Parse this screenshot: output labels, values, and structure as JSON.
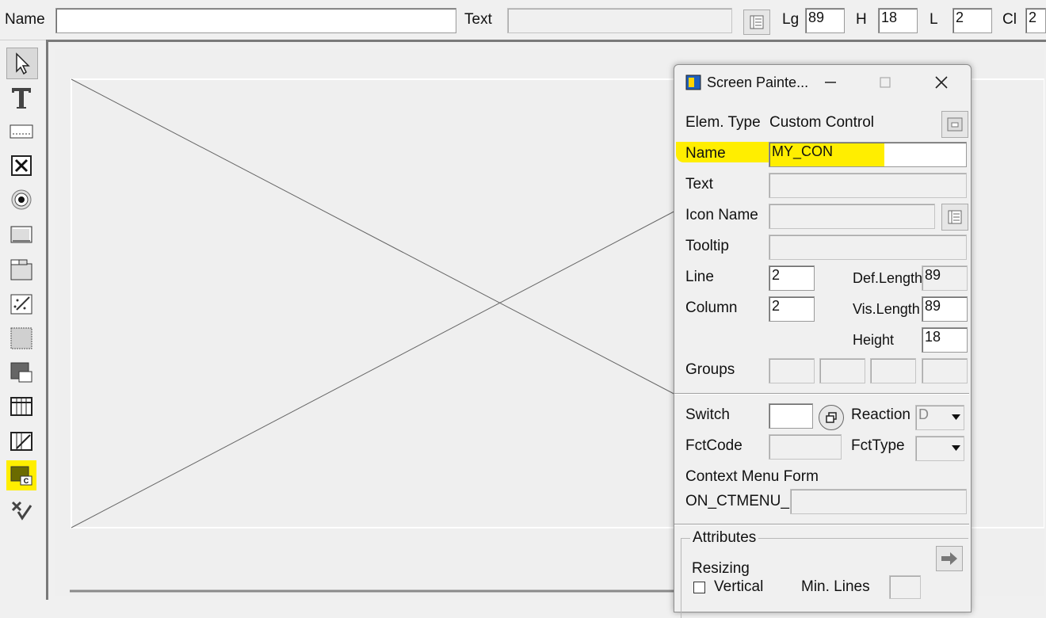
{
  "topbar": {
    "name_label": "Name",
    "name_value": "",
    "text_label": "Text",
    "text_value": "",
    "lg_label": "Lg",
    "lg_value": "89",
    "h_label": "H",
    "h_value": "18",
    "l_label": "L",
    "l_value": "2",
    "cl_label": "Cl",
    "cl_value": "2"
  },
  "toolbox": {
    "tools": [
      {
        "icon": "pointer-icon"
      },
      {
        "icon": "text-tool-icon"
      },
      {
        "icon": "input-field-icon"
      },
      {
        "icon": "checkbox-icon"
      },
      {
        "icon": "radio-button-icon"
      },
      {
        "icon": "pushbutton-icon"
      },
      {
        "icon": "tabstrip-icon"
      },
      {
        "icon": "tabstrip-wizard-icon"
      },
      {
        "icon": "box-icon"
      },
      {
        "icon": "subscreen-icon"
      },
      {
        "icon": "table-control-icon"
      },
      {
        "icon": "table-wizard-icon"
      },
      {
        "icon": "custom-control-icon"
      },
      {
        "icon": "status-icon"
      }
    ],
    "highlight_color": "#ffee00"
  },
  "dialog": {
    "title": "Screen Painte...",
    "elem_type_label": "Elem. Type",
    "elem_type_value": "Custom Control",
    "name_label": "Name",
    "name_value": "MY_CON",
    "text_label": "Text",
    "text_value": "",
    "icon_name_label": "Icon Name",
    "icon_name_value": "",
    "tooltip_label": "Tooltip",
    "tooltip_value": "",
    "line_label": "Line",
    "line_value": "2",
    "column_label": "Column",
    "column_value": "2",
    "def_length_label": "Def.Length",
    "def_length_value": "89",
    "vis_length_label": "Vis.Length",
    "vis_length_value": "89",
    "height_label": "Height",
    "height_value": "18",
    "groups_label": "Groups",
    "switch_label": "Switch",
    "reaction_label": "Reaction",
    "reaction_value": "D",
    "fctcode_label": "FctCode",
    "fcttype_label": "FctType",
    "context_menu_label": "Context Menu Form",
    "ctmenu_prefix": "ON_CTMENU_",
    "attributes_label": "Attributes",
    "resizing_label": "Resizing",
    "vertical_label": "Vertical",
    "min_lines_label": "Min. Lines"
  }
}
